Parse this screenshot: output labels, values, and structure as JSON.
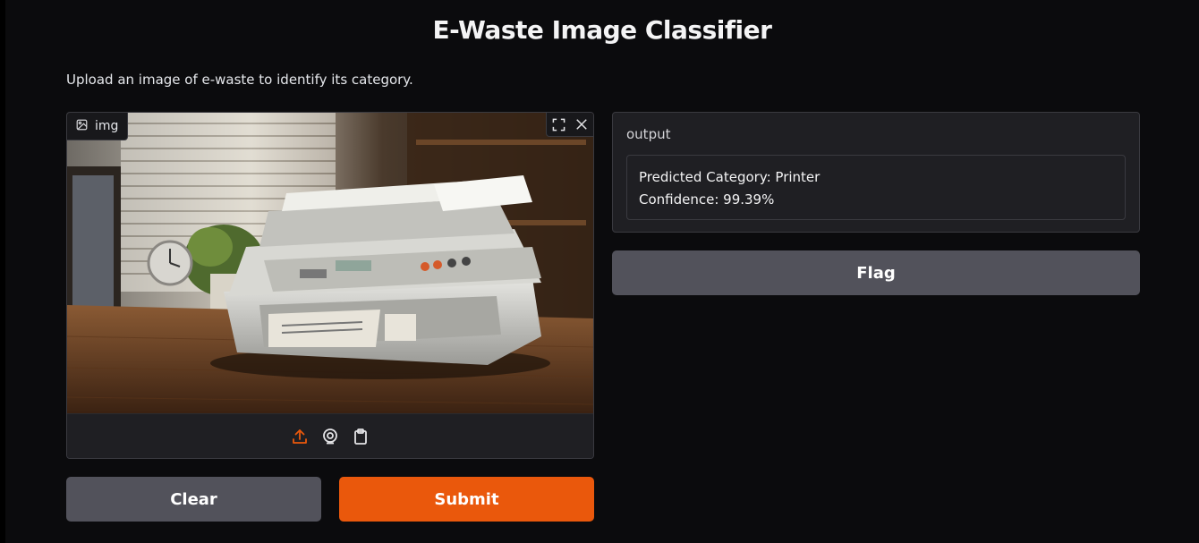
{
  "app": {
    "title": "E-Waste Image Classifier",
    "description": "Upload an image of e-waste to identify its category."
  },
  "input": {
    "label": "img",
    "label_icon": "image-icon",
    "tools": [
      "fullscreen-icon",
      "close-icon"
    ],
    "sources": [
      "upload-icon",
      "webcam-icon",
      "clipboard-icon"
    ],
    "active_source_color": "#ea580c",
    "image_subject": "printer"
  },
  "output": {
    "label": "output",
    "line1": "Predicted Category: Printer",
    "line2": "Confidence: 99.39%"
  },
  "buttons": {
    "flag": "Flag",
    "clear": "Clear",
    "submit": "Submit"
  },
  "colors": {
    "accent": "#ea580c",
    "secondary": "#52525b",
    "background": "#0b0b0d",
    "panel": "#1f1f23"
  }
}
